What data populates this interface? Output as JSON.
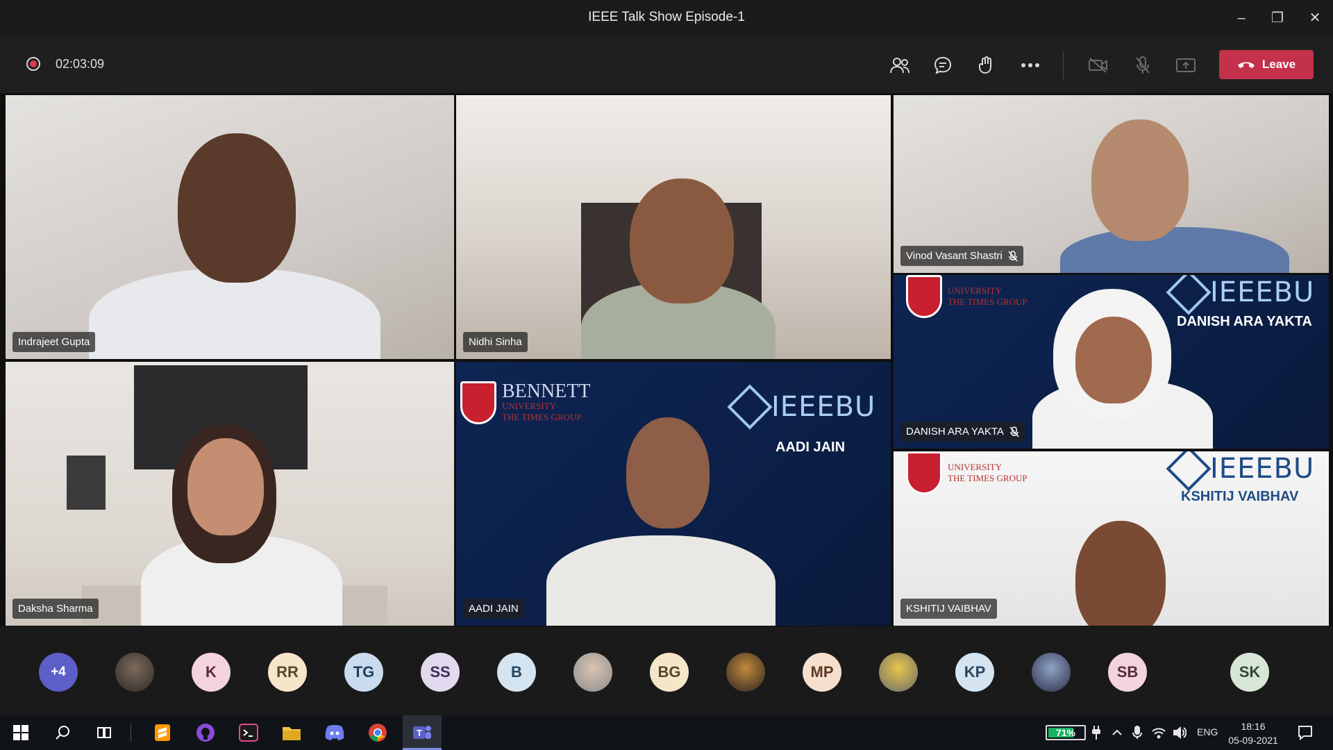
{
  "window": {
    "title": "IEEE Talk Show Episode-1"
  },
  "meeting": {
    "recording_time": "02:03:09",
    "leave_label": "Leave",
    "toolbar_icons": [
      "participants-icon",
      "chat-icon",
      "reactions-icon",
      "more-options-icon",
      "camera-off-icon",
      "mic-off-icon",
      "share-screen-icon"
    ]
  },
  "participants_video": [
    {
      "name": "Indrajeet Gupta",
      "muted": false
    },
    {
      "name": "Nidhi Sinha",
      "muted": false
    },
    {
      "name": "Vinod Vasant Shastri",
      "muted": true
    },
    {
      "name": "DANISH ARA YAKTA",
      "muted": true
    },
    {
      "name": "Daksha Sharma",
      "muted": false
    },
    {
      "name": "AADI JAIN",
      "muted": false
    },
    {
      "name": "KSHITIJ VAIBHAV",
      "muted": false
    }
  ],
  "overlays": {
    "ieee_brand": "IEEEBU",
    "aadi_caption": "AADI JAIN",
    "danish_caption": "DANISH ARA YAKTA",
    "kshitij_caption": "KSHITIJ VAIBHAV",
    "bennett_name": "BENNETT",
    "bennett_univ": "UNIVERSITY",
    "bennett_group": "THE TIMES GROUP"
  },
  "avatars": [
    "+4",
    "",
    "K",
    "RR",
    "TG",
    "SS",
    "B",
    "",
    "BG",
    "",
    "MP",
    "",
    "KP",
    "",
    "SB",
    "SK"
  ],
  "taskbar": {
    "battery": "71%",
    "battery_level": 0.71,
    "language": "ENG",
    "time": "18:16",
    "date": "05-09-2021"
  }
}
